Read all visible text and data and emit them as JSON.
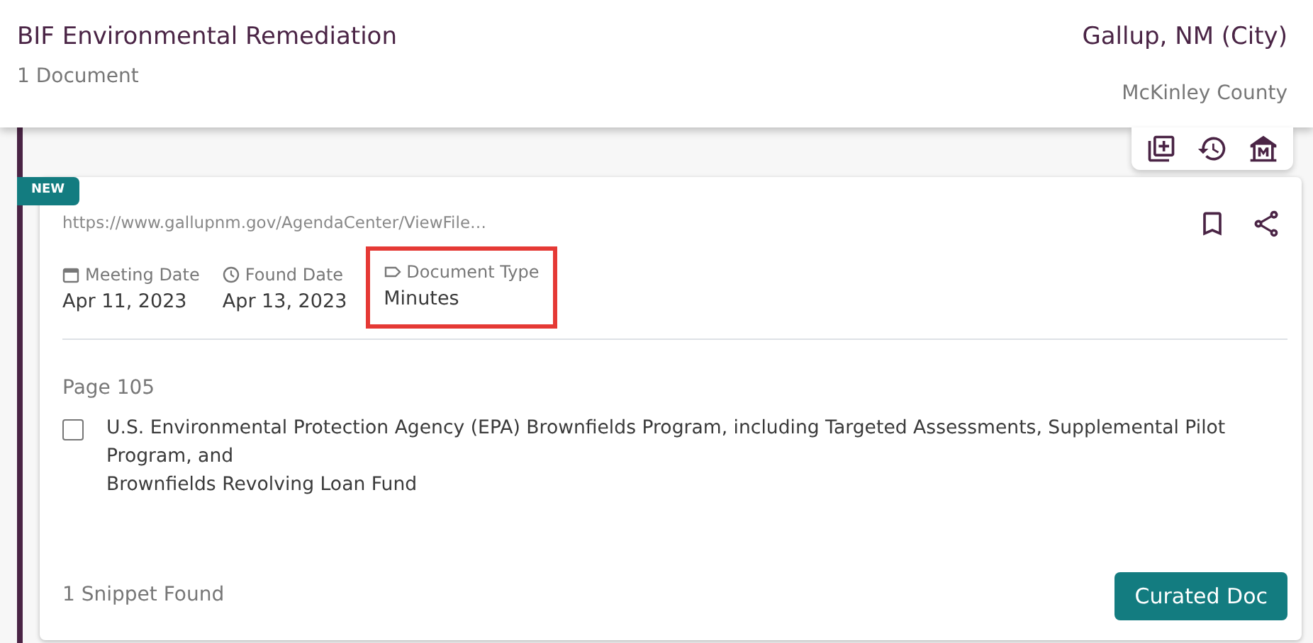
{
  "header": {
    "title": "BIF Environmental Remediation",
    "count": "1 Document",
    "location": "Gallup, NM (City)",
    "county": "McKinley County"
  },
  "document": {
    "badge": "NEW",
    "url": "https://www.gallupnm.gov/AgendaCenter/ViewFile…",
    "bookmarked": false,
    "meta": [
      {
        "kind": "calendar",
        "label": "Meeting Date",
        "value": "Apr 11, 2023",
        "highlighted": false
      },
      {
        "kind": "clock",
        "label": "Found Date",
        "value": "Apr 13, 2023",
        "highlighted": false
      },
      {
        "kind": "tag",
        "label": "Document Type",
        "value": "Minutes",
        "highlighted": true
      }
    ],
    "page": "Page 105",
    "snippets": [
      {
        "checked": false,
        "lines": [
          "U.S. Environmental Protection Agency (EPA) Brownfields Program, including Targeted Assessments, Supplemental Pilot Program, and",
          "Brownfields Revolving Loan Fund"
        ]
      }
    ],
    "footer": "1 Snippet Found",
    "button": "Curated Doc"
  }
}
